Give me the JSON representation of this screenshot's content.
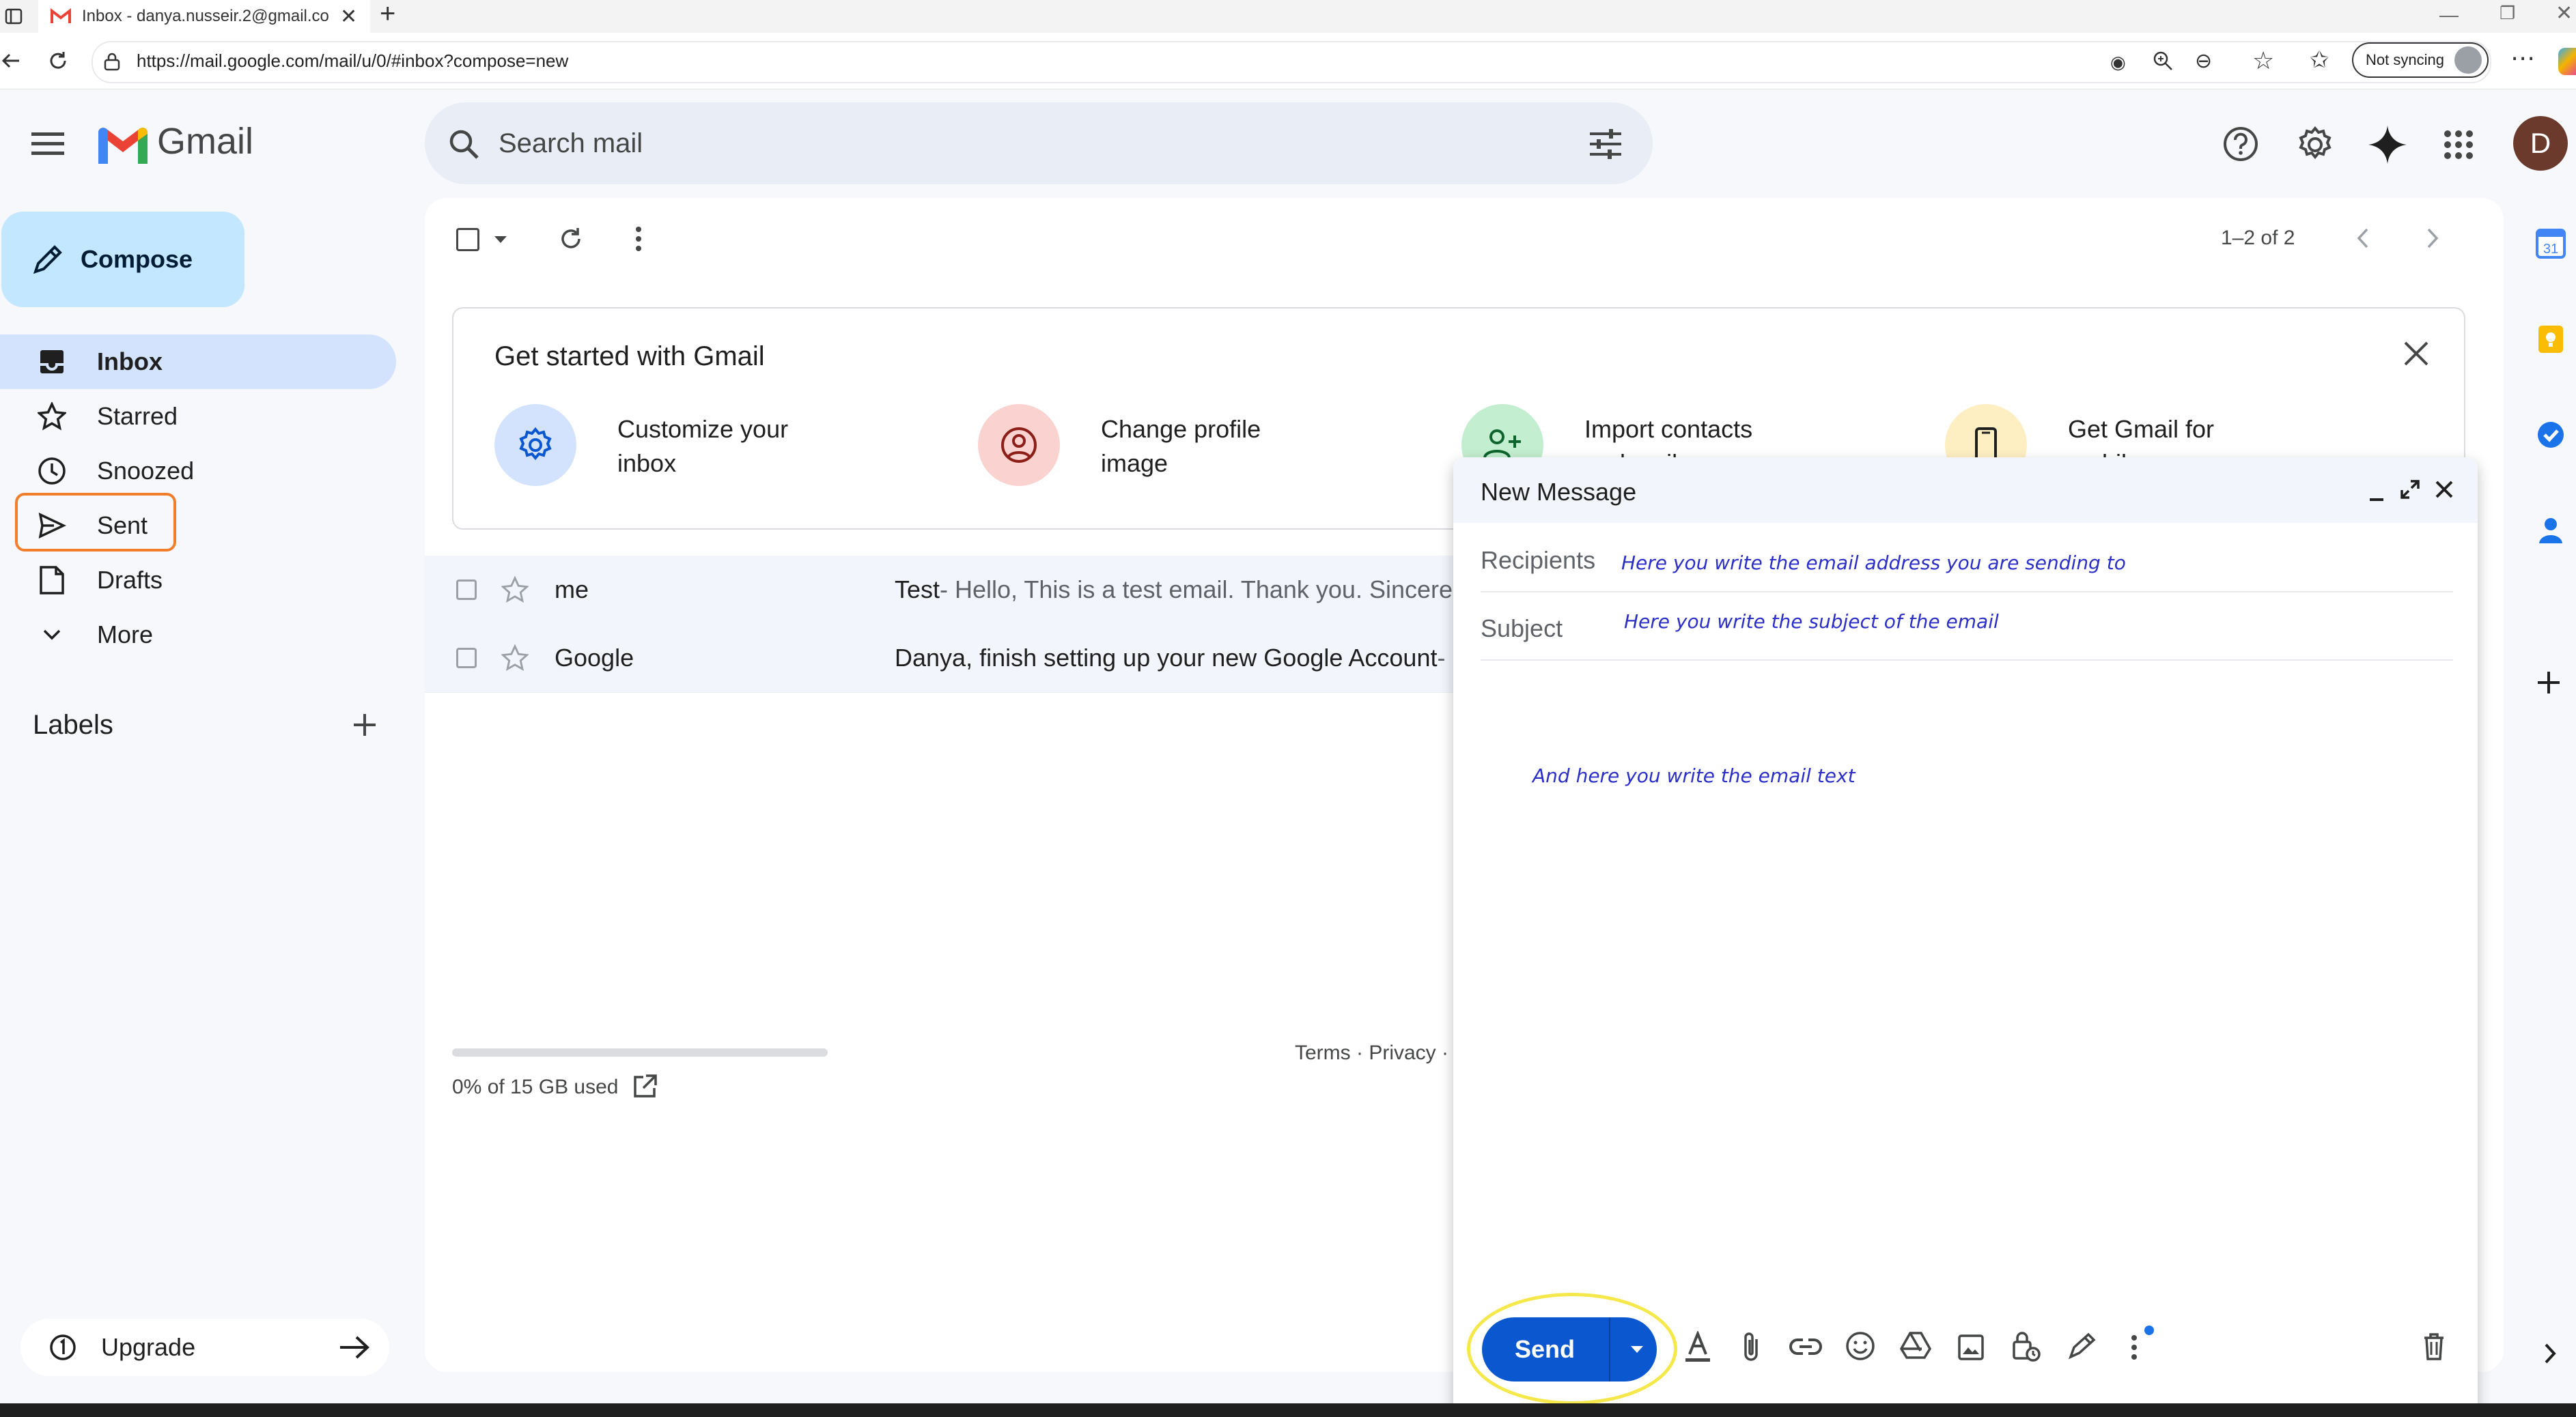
{
  "browser": {
    "tab_title": "Inbox - danya.nusseir.2@gmail.co",
    "url": "https://mail.google.com/mail/u/0/#inbox?compose=new",
    "sync_label": "Not syncing"
  },
  "header": {
    "brand": "Gmail",
    "search_placeholder": "Search mail",
    "avatar_initial": "D"
  },
  "sidebar": {
    "compose_label": "Compose",
    "items": [
      {
        "label": "Inbox",
        "icon": "inbox-icon"
      },
      {
        "label": "Starred",
        "icon": "star-icon"
      },
      {
        "label": "Snoozed",
        "icon": "clock-icon"
      },
      {
        "label": "Sent",
        "icon": "send-icon"
      },
      {
        "label": "Drafts",
        "icon": "draft-icon"
      },
      {
        "label": "More",
        "icon": "chevron-down-icon"
      }
    ],
    "labels_title": "Labels",
    "upgrade_label": "Upgrade"
  },
  "toolbar": {
    "pager": "1–2 of 2"
  },
  "get_started": {
    "title": "Get started with Gmail",
    "tiles": [
      {
        "line1": "Customize your",
        "line2": "inbox",
        "icon": "gear-icon",
        "color": "#d3e3fd"
      },
      {
        "line1": "Change profile",
        "line2": "image",
        "icon": "account-icon",
        "color": "#fad2cf"
      },
      {
        "line1": "Import contacts",
        "line2": "and mail",
        "icon": "add-person-icon",
        "color": "#c4eed0"
      },
      {
        "line1": "Get Gmail for",
        "line2": "mobile",
        "icon": "phone-icon",
        "color": "#feefc3"
      }
    ]
  },
  "emails": [
    {
      "sender": "me",
      "subject": "Test",
      "snippet": " - Hello, This is a test email. Thank you. Sincerely"
    },
    {
      "sender": "Google",
      "subject": "Danya, finish setting up your new Google Account",
      "snippet": " -"
    }
  ],
  "footer": {
    "storage": "0% of 15 GB used",
    "links": "Terms · Privacy · P"
  },
  "compose_window": {
    "title": "New Message",
    "recipients_label": "Recipients",
    "recipients_hint": "Here you write the email address you are sending to",
    "subject_label": "Subject",
    "subject_hint": "Here you write the subject of the email",
    "body_hint": "And here you write the email text",
    "send_label": "Send"
  },
  "colors": {
    "accent": "#0b57d0",
    "compose_bg": "#c2e7ff",
    "active_nav": "#d3e3fd",
    "sent_highlight": "#f27d2a",
    "send_highlight": "#f5e84a",
    "hint_text": "#2b2fc8"
  }
}
